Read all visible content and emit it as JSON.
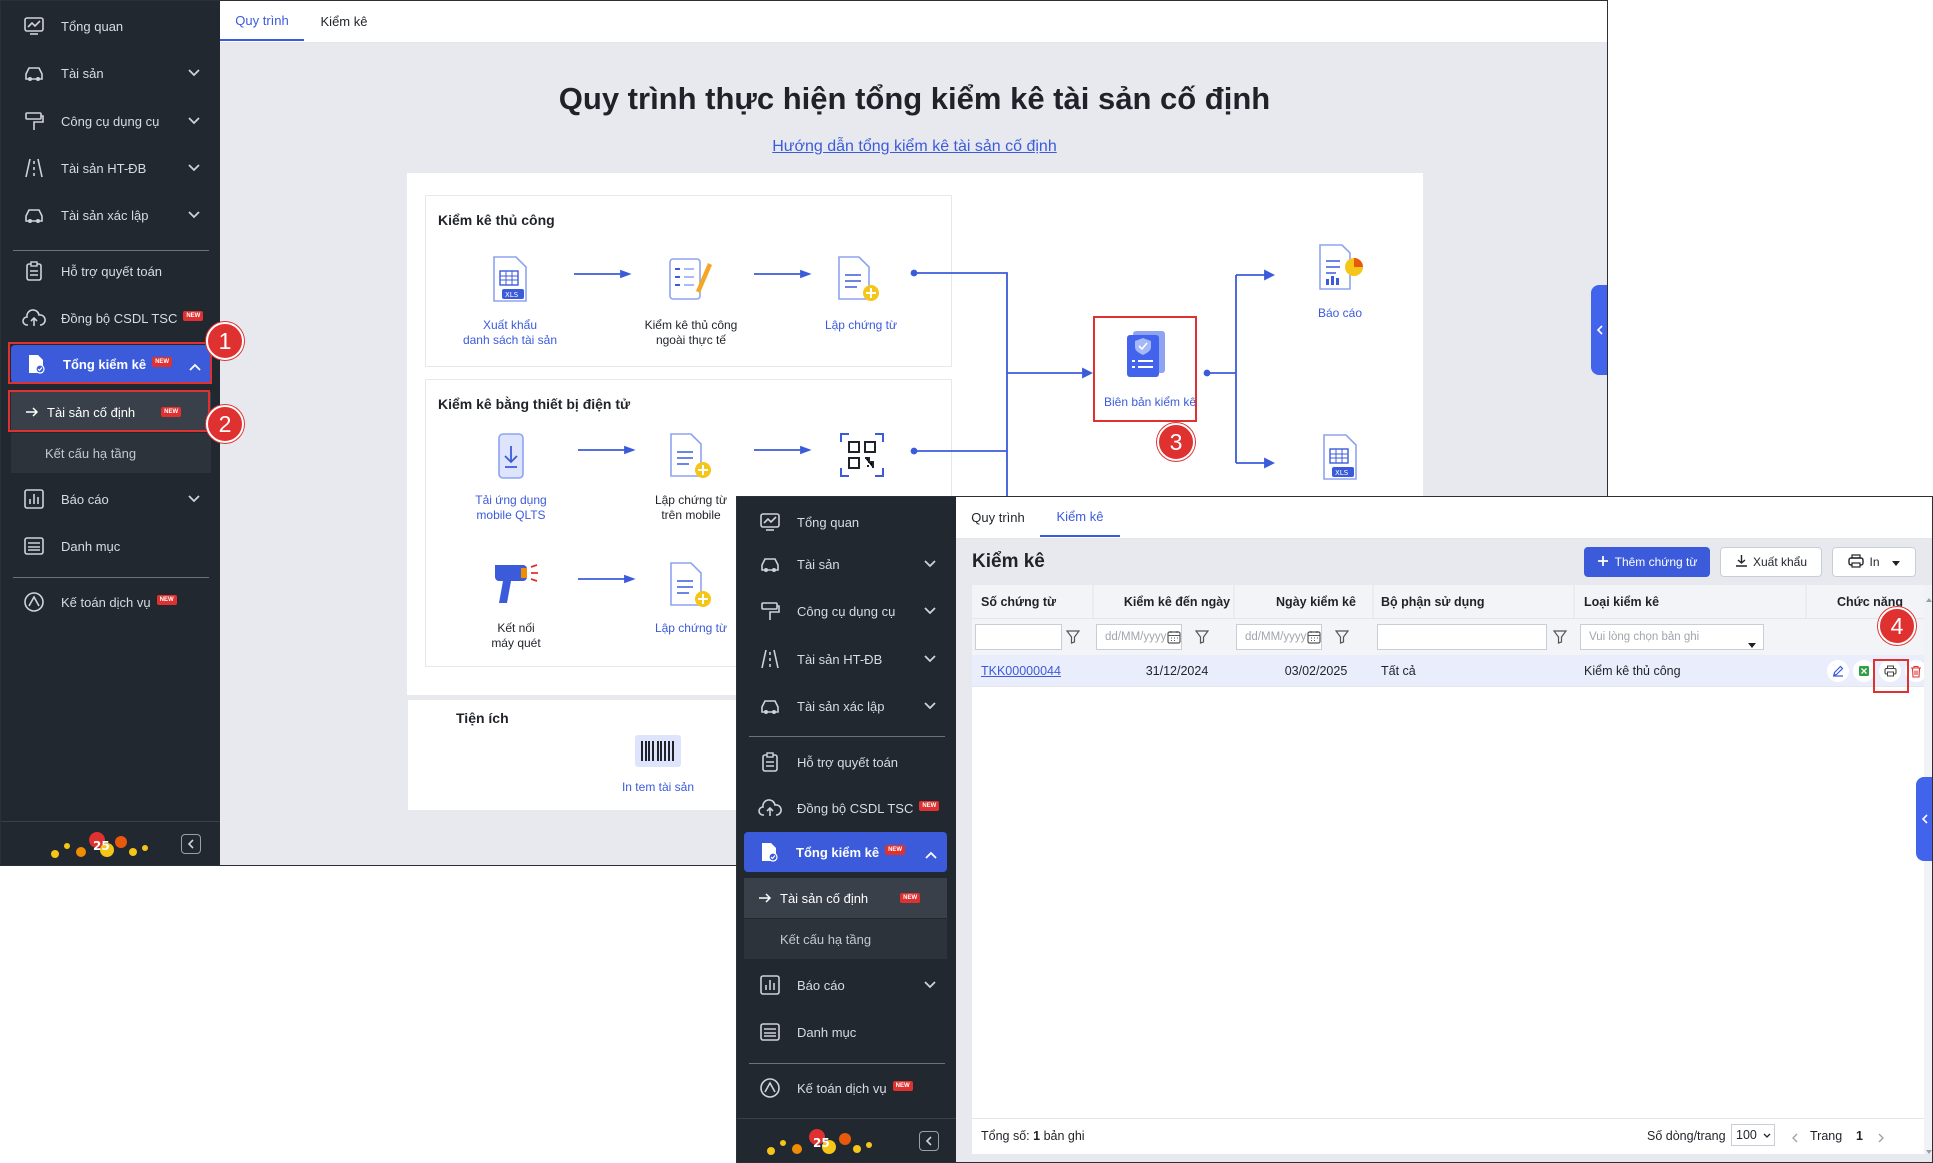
{
  "sidebar_items": {
    "tong_quan": "Tổng quan",
    "tai_san": "Tài sản",
    "cong_cu": "Công cụ dụng cụ",
    "tai_san_htdb": "Tài sản HT-ĐB",
    "tai_san_xac_lap": "Tài sản xác lập",
    "ho_tro": "Hỗ trợ quyết toán",
    "dong_bo": "Đồng bộ CSDL TSC",
    "tong_kiem_ke": "Tổng kiểm kê",
    "tscd": "Tài sản cố định",
    "ket_cau": "Kết cấu hạ tầng",
    "bao_cao": "Báo cáo",
    "danh_muc": "Danh mục",
    "ke_toan": "Kế toán dịch vụ",
    "new_badge": "NEW"
  },
  "tabs": {
    "quy_trinh": "Quy trình",
    "kiem_ke": "Kiểm kê"
  },
  "flow": {
    "title": "Quy trình thực hiện tổng kiểm kê tài sản cố định",
    "guide_link": "Hướng dẫn tổng kiểm kê tài sản cố định",
    "manual_title": "Kiểm kê thủ công",
    "export_list_1": "Xuất khẩu",
    "export_list_2": "danh sách tài sản",
    "manual_check_1": "Kiểm kê thủ công",
    "manual_check_2": "ngoài thực tế",
    "create_voucher": "Lập chứng từ",
    "device_title": "Kiểm kê bằng thiết bị điện tử",
    "download_app_1": "Tải ứng dụng",
    "download_app_2": "mobile QLTS",
    "mobile_voucher_1": "Lập chứng từ",
    "mobile_voucher_2": "trên mobile",
    "connect_scanner_1": "Kết nối",
    "connect_scanner_2": "máy quét",
    "create_voucher_2": "Lập chứng từ",
    "record": "Biên bản kiểm kê",
    "report": "Báo cáo",
    "xls": "XLS",
    "utility_title": "Tiện ích",
    "print_label": "In tem tài sản"
  },
  "annotations": {
    "n1": "1",
    "n2": "2",
    "n3": "3",
    "n4": "4"
  },
  "list": {
    "page_title": "Kiểm kê",
    "add_button": "Thêm chứng từ",
    "export_button": "Xuất khẩu",
    "print_button": "In",
    "columns": {
      "so_ct": "Số chứng từ",
      "den_ngay": "Kiểm kê đến ngày",
      "ngay_kk": "Ngày kiểm kê",
      "bo_phan": "Bộ phận sử dụng",
      "loai": "Loại kiểm kê",
      "chuc_nang": "Chức năng"
    },
    "date_placeholder": "dd/MM/yyyy",
    "select_placeholder": "Vui lòng chọn bản ghi",
    "row": {
      "so_ct": "TKK00000044",
      "den_ngay": "31/12/2024",
      "ngay_kk": "03/02/2025",
      "bo_phan": "Tất cả",
      "loai": "Kiểm kê thủ công"
    },
    "footer": {
      "total_label": "Tổng số:",
      "total_value": "1",
      "total_unit": "bản ghi",
      "rows_per_page_label": "Số dòng/trang",
      "rows_per_page": "100",
      "page_label": "Trang",
      "page": "1"
    }
  }
}
